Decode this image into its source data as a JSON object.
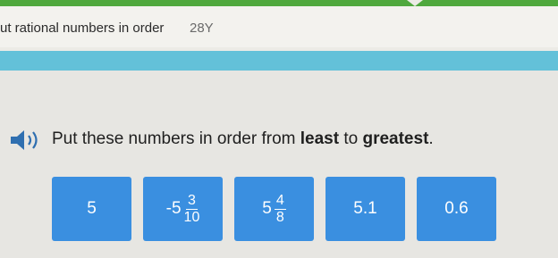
{
  "header": {
    "title": "ut rational numbers in order",
    "code": "28Y"
  },
  "question": {
    "pre": "Put these numbers in order from ",
    "least": "least",
    "mid": " to ",
    "greatest": "greatest",
    "end": "."
  },
  "tiles": [
    {
      "label": "5"
    },
    {
      "whole": "-5",
      "numerator": "3",
      "denominator": "10"
    },
    {
      "whole": "5",
      "numerator": "4",
      "denominator": "8"
    },
    {
      "label": "5.1"
    },
    {
      "label": "0.6"
    }
  ],
  "colors": {
    "tile": "#3a8fe0",
    "banner": "#63c1d9",
    "top_stripe": "#4fa83d",
    "speaker": "#2f6fb0"
  },
  "icons": {
    "speaker": "speaker-icon"
  }
}
